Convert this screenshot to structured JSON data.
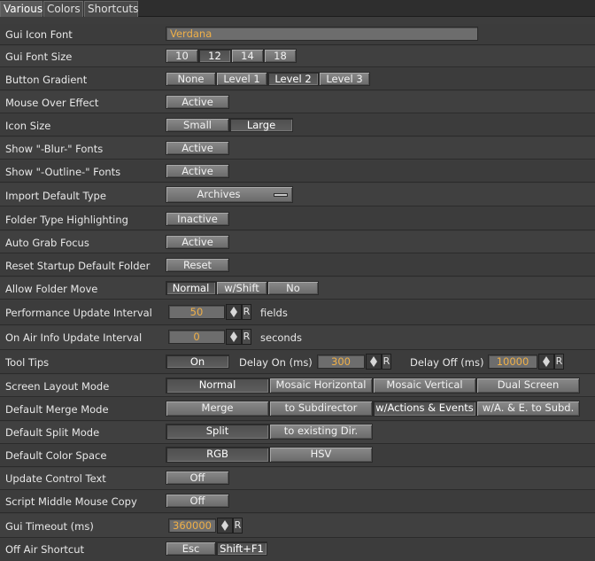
{
  "tabs": [
    "Various",
    "Colors",
    "Shortcuts"
  ],
  "rows": {
    "gui_icon_font": {
      "label": "Gui Icon Font",
      "value": "Verdana"
    },
    "gui_font_size": {
      "label": "Gui Font Size",
      "options": [
        "10",
        "12",
        "14",
        "18"
      ],
      "selected": 1
    },
    "button_gradient": {
      "label": "Button Gradient",
      "options": [
        "None",
        "Level 1",
        "Level 2",
        "Level 3"
      ],
      "selected": 2
    },
    "mouse_over_effect": {
      "label": "Mouse Over Effect",
      "value": "Active"
    },
    "icon_size": {
      "label": "Icon Size",
      "options": [
        "Small",
        "Large"
      ],
      "selected": 1
    },
    "show_blur_fonts": {
      "label": "Show \"-Blur-\" Fonts",
      "value": "Active"
    },
    "show_outline_fonts": {
      "label": "Show \"-Outline-\" Fonts",
      "value": "Active"
    },
    "import_default_type": {
      "label": "Import Default Type",
      "value": "Archives"
    },
    "folder_type_highlighting": {
      "label": "Folder Type Highlighting",
      "value": "Inactive"
    },
    "auto_grab_focus": {
      "label": "Auto Grab Focus",
      "value": "Active"
    },
    "reset_startup_default_folder": {
      "label": "Reset Startup Default Folder",
      "value": "Reset"
    },
    "allow_folder_move": {
      "label": "Allow Folder Move",
      "options": [
        "Normal",
        "w/Shift",
        "No"
      ],
      "selected": 0
    },
    "performance_update_interval": {
      "label": "Performance Update Interval",
      "value": "50",
      "unit": "fields",
      "reset": "R"
    },
    "on_air_info_update_interval": {
      "label": "On Air Info Update Interval",
      "value": "0",
      "unit": "seconds",
      "reset": "R"
    },
    "tool_tips": {
      "label": "Tool Tips",
      "value": "On",
      "delay_on_label": "Delay On (ms)",
      "delay_on_value": "300",
      "delay_off_label": "Delay Off (ms)",
      "delay_off_value": "10000",
      "reset": "R"
    },
    "screen_layout_mode": {
      "label": "Screen Layout Mode",
      "options": [
        "Normal",
        "Mosaic Horizontal",
        "Mosaic Vertical",
        "Dual Screen"
      ],
      "selected": 0
    },
    "default_merge_mode": {
      "label": "Default Merge Mode",
      "options": [
        "Merge",
        "to Subdirector",
        "w/Actions & Events",
        "w/A. & E. to Subd."
      ],
      "selected": 2
    },
    "default_split_mode": {
      "label": "Default Split Mode",
      "options": [
        "Split",
        "to existing Dir."
      ],
      "selected": 0
    },
    "default_color_space": {
      "label": "Default Color Space",
      "options": [
        "RGB",
        "HSV"
      ],
      "selected": 0
    },
    "update_control_text": {
      "label": "Update Control Text",
      "value": "Off"
    },
    "script_middle_mouse_copy": {
      "label": "Script Middle Mouse Copy",
      "value": "Off"
    },
    "gui_timeout": {
      "label": "Gui Timeout (ms)",
      "value": "360000",
      "reset": "R"
    },
    "off_air_shortcut": {
      "label": "Off Air Shortcut",
      "options": [
        "Esc",
        "Shift+F1"
      ],
      "selected": 1
    }
  },
  "colors": {
    "background": "#3d3d3d",
    "value_text": "#f0b048",
    "label_text": "#e8e8e8"
  },
  "icons": {
    "spinner": "spin-up-down-icon",
    "dropdown": "dropdown-bar-icon"
  }
}
